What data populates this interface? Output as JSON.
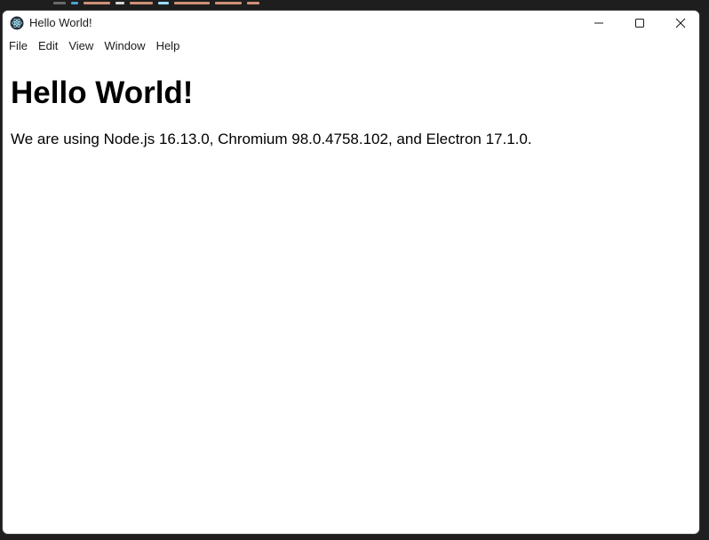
{
  "window": {
    "title": "Hello World!",
    "app_icon": "electron-icon",
    "controls": {
      "minimize": "minimize-icon",
      "maximize": "maximize-icon",
      "close": "close-icon"
    }
  },
  "menu": {
    "items": [
      {
        "label": "File"
      },
      {
        "label": "Edit"
      },
      {
        "label": "View"
      },
      {
        "label": "Window"
      },
      {
        "label": "Help"
      }
    ]
  },
  "page": {
    "heading": "Hello World!",
    "body_prefix": "We are using Node.js ",
    "node_version": "16.13.0",
    "chromium_label": ", Chromium ",
    "chromium_version": "98.0.4758.102",
    "electron_label": ", and Electron ",
    "electron_version": "17.1.0",
    "body_suffix": "."
  },
  "colors": {
    "window_bg": "#ffffff",
    "text": "#000000",
    "desktop_bg": "#1f1f1f"
  }
}
